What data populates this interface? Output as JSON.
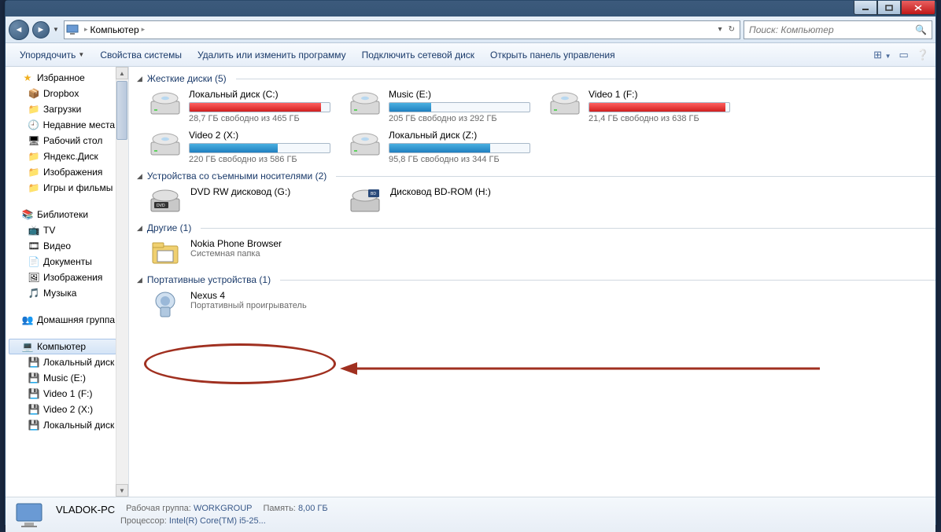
{
  "titlebar": {},
  "nav": {
    "breadcrumb_item": "Компьютер",
    "search_placeholder": "Поиск: Компьютер"
  },
  "toolbar": {
    "organize": "Упорядочить",
    "system_props": "Свойства системы",
    "uninstall": "Удалить или изменить программу",
    "map_drive": "Подключить сетевой диск",
    "control_panel": "Открыть панель управления"
  },
  "sidebar": {
    "favorites": {
      "label": "Избранное",
      "items": [
        "Dropbox",
        "Загрузки",
        "Недавние места",
        "Рабочий стол",
        "Яндекс.Диск",
        "Изображения",
        "Игры и фильмы"
      ]
    },
    "libraries": {
      "label": "Библиотеки",
      "items": [
        "TV",
        "Видео",
        "Документы",
        "Изображения",
        "Музыка"
      ]
    },
    "homegroup": {
      "label": "Домашняя группа"
    },
    "computer": {
      "label": "Компьютер",
      "items": [
        "Локальный диск",
        "Music (E:)",
        "Video 1 (F:)",
        "Video 2 (X:)",
        "Локальный диск"
      ]
    }
  },
  "content": {
    "cat_disks": {
      "label": "Жесткие диски (5)",
      "drives": [
        {
          "name": "Локальный диск (C:)",
          "free": "28,7 ГБ свободно из 465 ГБ",
          "fill": 94,
          "color": "red"
        },
        {
          "name": "Music (E:)",
          "free": "205 ГБ свободно из 292 ГБ",
          "fill": 30,
          "color": "blue"
        },
        {
          "name": "Video 1 (F:)",
          "free": "21,4 ГБ свободно из 638 ГБ",
          "fill": 97,
          "color": "red"
        },
        {
          "name": "Video 2 (X:)",
          "free": "220 ГБ свободно из 586 ГБ",
          "fill": 63,
          "color": "blue"
        },
        {
          "name": "Локальный диск (Z:)",
          "free": "95,8 ГБ свободно из 344 ГБ",
          "fill": 72,
          "color": "blue"
        }
      ]
    },
    "cat_removable": {
      "label": "Устройства со съемными носителями (2)",
      "items": [
        {
          "name": "DVD RW дисковод (G:)",
          "type": "dvd"
        },
        {
          "name": "Дисковод BD-ROM (H:)",
          "type": "bd"
        }
      ]
    },
    "cat_other": {
      "label": "Другие (1)",
      "items": [
        {
          "name": "Nokia Phone Browser",
          "sub": "Системная папка"
        }
      ]
    },
    "cat_portable": {
      "label": "Портативные устройства (1)",
      "items": [
        {
          "name": "Nexus 4",
          "sub": "Портативный проигрыватель"
        }
      ]
    }
  },
  "status": {
    "name": "VLADOK-PC",
    "workgroup_label": "Рабочая группа:",
    "workgroup": "WORKGROUP",
    "memory_label": "Память:",
    "memory": "8,00 ГБ",
    "cpu_label": "Процессор:",
    "cpu": "Intel(R) Core(TM) i5-25..."
  }
}
